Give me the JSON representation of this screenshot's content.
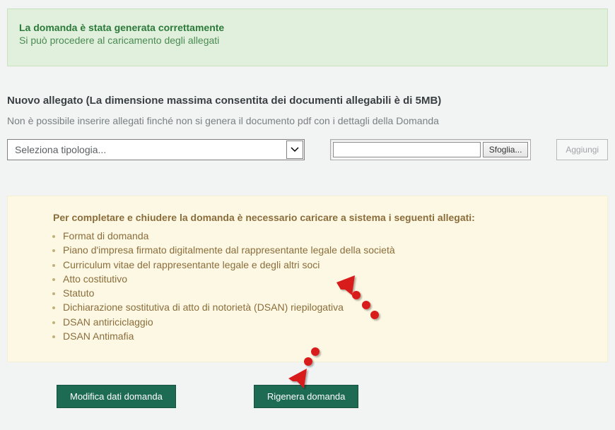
{
  "alert": {
    "title": "La domanda è stata generata correttamente",
    "text": "Si può procedere al caricamento degli allegati"
  },
  "section": {
    "title": "Nuovo allegato (La dimensione massima consentita dei documenti allegabili è di 5MB)",
    "subtext": "Non è possibile inserire allegati finché non si genera il documento pdf con i dettagli della Domanda"
  },
  "controls": {
    "select_placeholder": "Seleziona tipologia...",
    "browse_label": "Sfoglia...",
    "add_label": "Aggiungi"
  },
  "required": {
    "title": "Per completare e chiudere la domanda è necessario caricare a sistema i seguenti allegati:",
    "items": [
      "Format di domanda",
      "Piano d'impresa firmato digitalmente dal rappresentante legale della società",
      "Curriculum vitae del rappresentante legale e degli altri soci",
      "Atto costitutivo",
      "Statuto",
      "Dichiarazione sostitutiva di atto di notorietà (DSAN) riepilogativa",
      "DSAN antiriciclaggio",
      "DSAN Antimafia"
    ]
  },
  "buttons": {
    "modify": "Modifica dati domanda",
    "regenerate": "Rigenera domanda"
  }
}
